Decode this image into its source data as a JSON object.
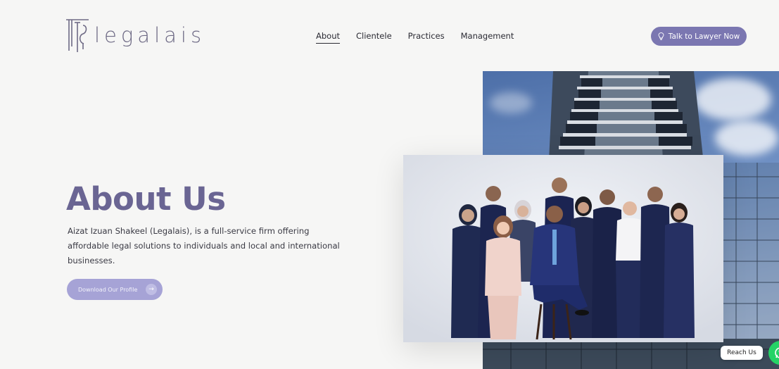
{
  "brand": {
    "mark": "ATS",
    "name": "legalais"
  },
  "nav": {
    "items": [
      "About",
      "Clientele",
      "Practices",
      "Management"
    ],
    "active": "About"
  },
  "cta": {
    "label": "Talk to Lawyer Now",
    "icon": "lightbulb-icon"
  },
  "hero": {
    "title": "About Us",
    "description": "Aizat Izuan Shakeel (Legalais), is a full-service firm offering affordable legal solutions to individuals and local and international businesses.",
    "download_label": "Download Our Profile",
    "download_icon": "arrow-right-icon"
  },
  "floating": {
    "reach_label": "Reach Us",
    "whatsapp_icon": "whatsapp-icon"
  },
  "colors": {
    "accent": "#7b77b1",
    "title": "#6a6593",
    "button_light": "#a6a3d6",
    "whatsapp": "#25d366"
  }
}
